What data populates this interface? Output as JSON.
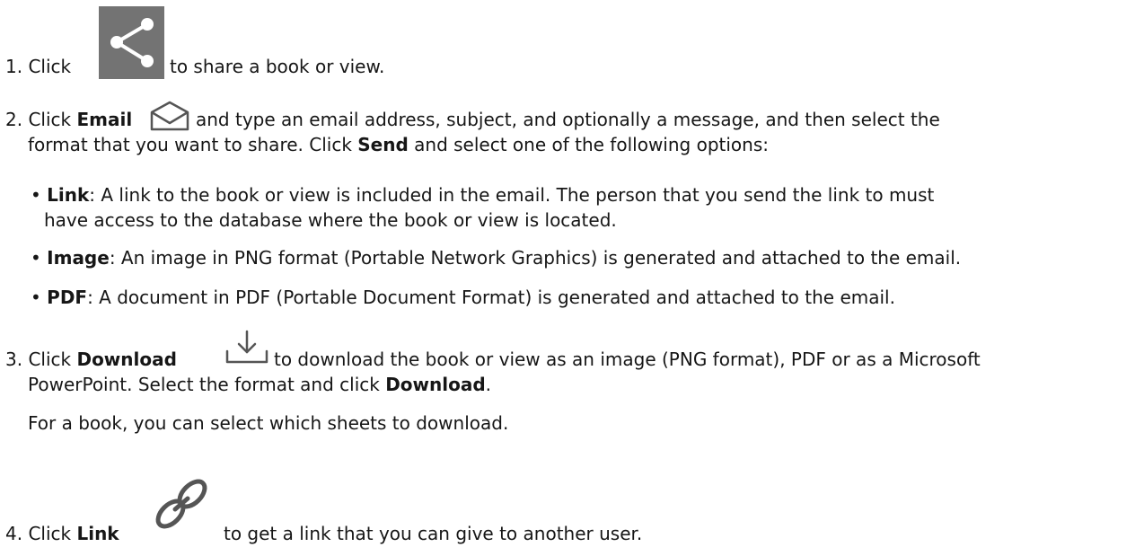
{
  "steps": {
    "s1": {
      "num": "1.",
      "pre": "Click",
      "post": "to share a book or view.",
      "icon": "share-icon"
    },
    "s2": {
      "num": "2.",
      "pre": "Click",
      "bold": "Email",
      "post": "and type an email address, subject, and optionally a message, and then select the",
      "line2_pre": "format that you want to share. Click",
      "line2_bold": "Send",
      "line2_post": "and select one of the following options:",
      "icon": "envelope-icon",
      "bullets": [
        {
          "term": "Link",
          "text": ": A link to the book or view is included in the email. The person that you send the link to must",
          "text2": "have access to the database where the book or view is located."
        },
        {
          "term": "Image",
          "text": ": An image in PNG format (Portable Network Graphics) is generated and attached to the email."
        },
        {
          "term": "PDF",
          "text": ": A document in PDF (Portable Document Format) is generated and attached to the email."
        }
      ]
    },
    "s3": {
      "num": "3.",
      "pre": "Click",
      "bold": "Download",
      "post": "to download the book or view as an image (PNG format), PDF or as a Microsoft",
      "line2_pre": "PowerPoint. Select the format and click",
      "line2_bold": "Download",
      "line2_post": ".",
      "note": "For a book, you can select which sheets to download.",
      "icon": "download-icon"
    },
    "s4": {
      "num": "4.",
      "pre": "Click",
      "bold": "Link",
      "post": "to get a link that you can give to another user.",
      "icon": "link-icon"
    }
  },
  "bullet_char": "•",
  "colors": {
    "text": "#161616",
    "share_icon_bg": "#737373",
    "icon_stroke": "#555555"
  }
}
